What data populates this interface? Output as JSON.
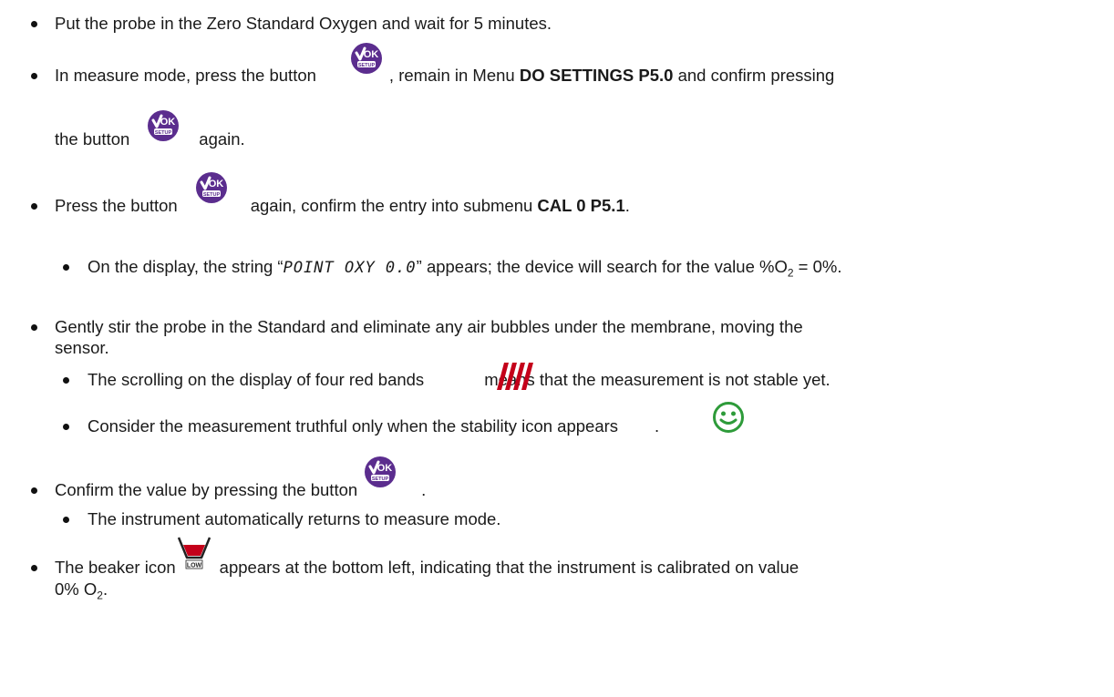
{
  "items": {
    "b1": {
      "text": "Put the probe in the Zero Standard Oxygen and wait for 5 minutes."
    },
    "b2": {
      "pre": "In measure mode, press the button",
      "mid": ", remain in Menu",
      "menu": "DO SETTINGS P5.0",
      "post": "and confirm pressing",
      "cont_pre": "the button",
      "cont_post": "again."
    },
    "b3": {
      "pre": "Press the button",
      "post": "again, confirm the entry into submenu",
      "submenu": "CAL 0 P5.1",
      "end": "."
    },
    "b3a": {
      "pre": "On the display, the string “",
      "lcd": "POINT OXY 0.0",
      "post": "” appears; the device will search for the value %O",
      "sub": "2",
      "end": " = 0%."
    },
    "b4": {
      "line1": "Gently stir the probe in the Standard and eliminate any air bubbles under the membrane, moving the",
      "line2": "sensor."
    },
    "b4a": {
      "pre": "The scrolling on the display of four red bands",
      "post": "means that the measurement is not stable yet."
    },
    "b4b": {
      "pre": "Consider the measurement truthful only when the stability icon appears",
      "post": "."
    },
    "b5": {
      "pre": "Confirm the value by pressing the button",
      "post": "."
    },
    "b5a": {
      "text": "The instrument automatically returns to measure mode."
    },
    "b6": {
      "pre": "The beaker icon",
      "post": "appears at the bottom left, indicating that the instrument is calibrated on value",
      "line2_pre": "0% O",
      "line2_sub": "2",
      "line2_end": "."
    }
  },
  "icons": {
    "ok_button": {
      "name": "ok-setup-button-icon",
      "label_top": "OK",
      "label_bottom": "SETUP",
      "color": "#5b2d8e"
    },
    "red_bands": {
      "name": "red-bands-icon",
      "color": "#c4001a"
    },
    "stability": {
      "name": "smiley-stability-icon",
      "color": "#2e9b3a"
    },
    "beaker": {
      "name": "beaker-low-icon",
      "label": "LOW",
      "color": "#c4001a"
    }
  }
}
